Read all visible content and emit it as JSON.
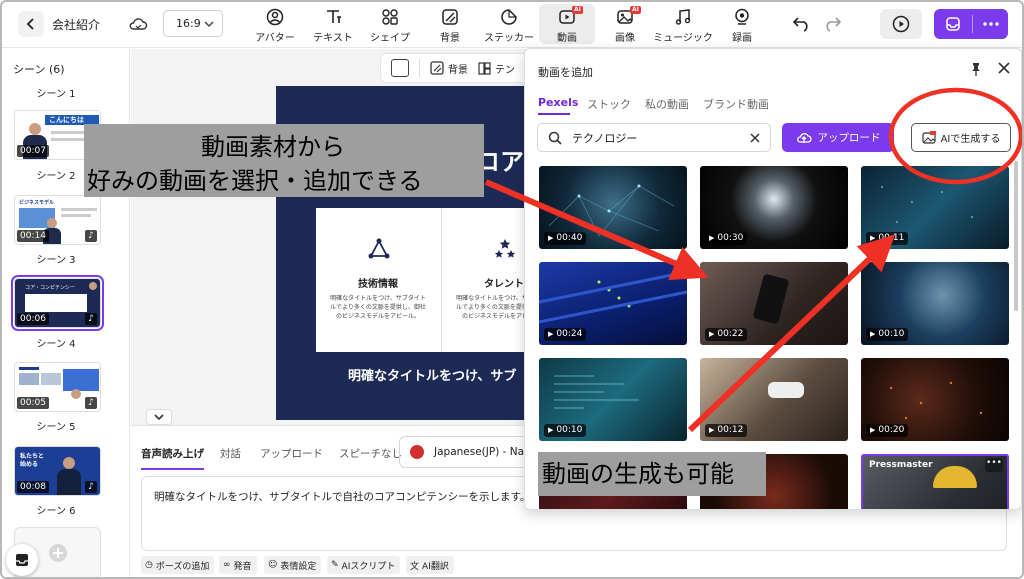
{
  "header": {
    "back_label": "会社紹介",
    "ratio": "16:9",
    "tools": [
      {
        "label": "アバター",
        "icon": "avatar-icon"
      },
      {
        "label": "テキスト",
        "icon": "text-icon"
      },
      {
        "label": "シェイプ",
        "icon": "shape-icon"
      },
      {
        "label": "背景",
        "icon": "background-icon"
      },
      {
        "label": "ステッカー",
        "icon": "sticker-icon"
      },
      {
        "label": "動画",
        "icon": "video-icon",
        "badge": "AI",
        "active": true
      },
      {
        "label": "画像",
        "icon": "image-icon",
        "badge": "AI"
      },
      {
        "label": "ミュージック",
        "icon": "music-icon"
      },
      {
        "label": "録画",
        "icon": "record-icon"
      }
    ],
    "accent_color": "#7c3aed"
  },
  "sidebar": {
    "heading": "シーン (6)",
    "scenes": [
      {
        "label": "シーン 1"
      },
      {
        "label": "シーン 2",
        "duration": "00:07",
        "title": "こんにちは"
      },
      {
        "label": "シーン 3",
        "duration": "00:14",
        "title": "ビジネスモデル"
      },
      {
        "label": "シーン 4",
        "duration": "00:06",
        "title": "コア・コンピテンシー",
        "selected": true
      },
      {
        "label": "シーン 5",
        "duration": "00:05"
      },
      {
        "label": "シーン 6",
        "duration": "00:08",
        "title": "私たちと\n始める"
      }
    ]
  },
  "canvas": {
    "toolbar": {
      "background_label": "背景",
      "layout_label": "テン"
    },
    "slide": {
      "heading_fragment": "コア",
      "cards": [
        {
          "title": "技術情報",
          "desc": "明確なタイトルをつけ、サブタイトルでより多くの文脈を提供し、御社のビジネスモデルをアピール。"
        },
        {
          "title": "タレント",
          "desc": "明確なタイトルをつけ、サブタイトルでより多くの文脈を提供し、御社のビジネスモデルをアピール。"
        }
      ],
      "caption": "明確なタイトルをつけ、サブ"
    }
  },
  "script_panel": {
    "tabs": [
      "音声読み上げ",
      "対話",
      "アップロード",
      "スピーチなし"
    ],
    "voice": "Japanese(JP) - Nao",
    "script_text": "明確なタイトルをつけ、サブタイトルで自社のコアコンピテンシーを示します。",
    "buttons": [
      {
        "label": "ポーズの追加",
        "icon": "clock-icon"
      },
      {
        "label": "発音",
        "icon": "glasses-icon"
      },
      {
        "label": "表情設定",
        "icon": "smile-icon"
      },
      {
        "label": "AIスクリプト",
        "icon": "ai-pen-icon"
      },
      {
        "label": "AI翻訳",
        "icon": "translate-icon"
      }
    ]
  },
  "video_panel": {
    "title": "動画を追加",
    "tabs": [
      "Pexels",
      "ストック",
      "私の動画",
      "ブランド動画"
    ],
    "search_value": "テクノロジー",
    "upload_label": "アップロード",
    "ai_label": "AIで生成する",
    "videos": [
      {
        "duration": "00:40",
        "theme": "network"
      },
      {
        "duration": "00:30",
        "theme": "globe"
      },
      {
        "duration": "00:11",
        "theme": "data"
      },
      {
        "duration": "00:24",
        "theme": "server"
      },
      {
        "duration": "00:22",
        "theme": "phone"
      },
      {
        "duration": "00:10",
        "theme": "earth"
      },
      {
        "duration": "00:10",
        "theme": "code"
      },
      {
        "duration": "00:12",
        "theme": "vr"
      },
      {
        "duration": "00:20",
        "theme": "lights"
      },
      {
        "duration": "",
        "theme": "abstract"
      },
      {
        "duration": "",
        "theme": "particles"
      },
      {
        "duration": "",
        "theme": "worker",
        "label": "Pressmaster",
        "selected": true
      }
    ]
  },
  "annotations": {
    "top_line1": "動画素材から",
    "top_line2": "好みの動画を選択・追加できる",
    "bottom": "動画の生成も可能",
    "arrow_color": "#ee3124"
  }
}
